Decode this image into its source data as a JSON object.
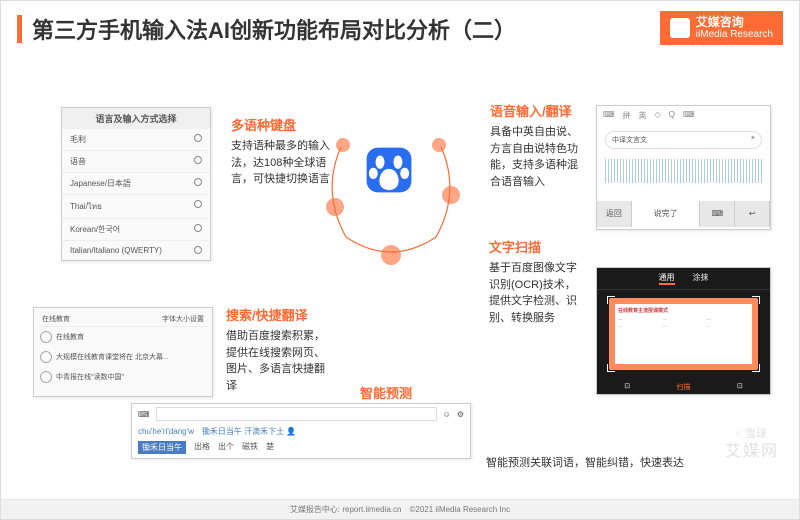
{
  "title": "第三方手机输入法AI创新功能布局对比分析（二）",
  "logo": {
    "name": "艾媒咨询",
    "sub": "iiMedia Research"
  },
  "features": {
    "multilang": {
      "title": "多语种键盘",
      "desc": "支持语种最多的输入法，达108种全球语言，可快捷切换语言"
    },
    "voice": {
      "title": "语音输入/翻译",
      "desc": "具备中英自由说、方言自由说特色功能，支持多语种混合语音输入"
    },
    "ocr": {
      "title": "文字扫描",
      "desc": "基于百度图像文字识别(OCR)技术，提供文字检测、识别、转换服务"
    },
    "search": {
      "title": "搜索/快捷翻译",
      "desc": "借助百度搜索积累，提供在线搜索网页、图片、多语言快捷翻译"
    },
    "predict": {
      "title": "智能预测",
      "desc": "智能预测关联词语，智能纠错，快速表达"
    }
  },
  "panels": {
    "lang": {
      "header": "语言及输入方式选择",
      "items": [
        "毛利",
        "语音",
        "Japanese/日本語",
        "Thai/ไทย",
        "Korean/한국어",
        "Italian/Italiano (QWERTY)"
      ]
    },
    "search": {
      "tab_left": "在线教育",
      "tab_right": "字体大小设置",
      "row1": "在线教育",
      "row2": "大规模在线教育课堂将在 北京大幕...",
      "row3": "中青报在线\"读数中国\""
    },
    "voice": {
      "tabs": [
        "⌨",
        "拼",
        "英",
        "◇",
        "Q",
        "⌨"
      ],
      "input": "中译文言文",
      "btn_left": "返回",
      "btn_mid": "说完了",
      "btn_r1": "",
      "btn_r2": ""
    },
    "ocr": {
      "tab1": "通用",
      "tab2": "涂抹",
      "doc_title": "在线教育主流授课模式",
      "bottom": [
        "⊡",
        "扫描",
        "⊡"
      ]
    },
    "predict": {
      "pinyin": "chu'he'ri'dang'w",
      "suggest": "锄禾日当午 汗滴禾下土",
      "candidates": [
        "锄禾日当午",
        "出格",
        "出个",
        "磁铁",
        "楚"
      ]
    }
  },
  "watermark": "艾媒网",
  "watermark2": "○ 雪球",
  "footer": "艾媒报告中心: report.iimedia.cn　©2021 iiMedia Research Inc"
}
